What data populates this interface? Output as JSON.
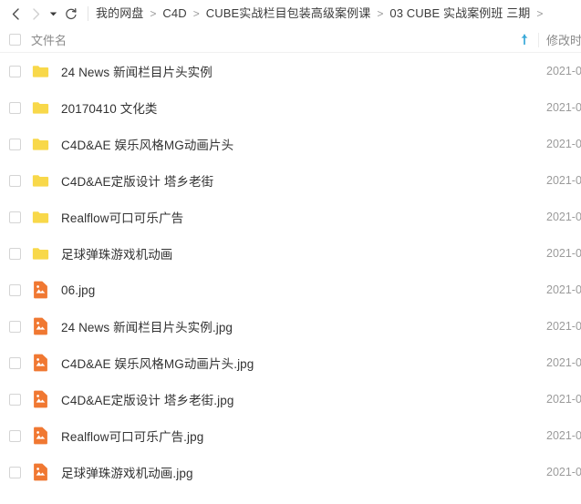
{
  "toolbar": {
    "back_icon": "chevron-left-icon",
    "forward_icon": "chevron-right-icon",
    "history_caret_icon": "caret-down-icon",
    "refresh_icon": "refresh-icon",
    "breadcrumb": [
      "我的网盘",
      "C4D",
      "CUBE实战栏目包装高级案例课",
      "03 CUBE 实战案例班 三期"
    ],
    "breadcrumb_separator": ">",
    "breadcrumb_trailing_separator": ">"
  },
  "header": {
    "select_all_label": "",
    "name_column": "文件名",
    "sort_icon": "sort-ascending-arrow-icon",
    "time_column": "修改时间"
  },
  "colors": {
    "folder": "#f8d84a",
    "image_file": "#f07832",
    "sort_arrow": "#37a8d8",
    "text": "#333333",
    "muted_text": "#8a8a8a"
  },
  "rows": [
    {
      "name": "24 News 新闻栏目片头实例",
      "type": "folder",
      "icon": "folder-icon",
      "time": "2021-0"
    },
    {
      "name": "20170410 文化类",
      "type": "folder",
      "icon": "folder-icon",
      "time": "2021-0"
    },
    {
      "name": "C4D&AE 娱乐风格MG动画片头",
      "type": "folder",
      "icon": "folder-icon",
      "time": "2021-0"
    },
    {
      "name": "C4D&AE定版设计 塔乡老街",
      "type": "folder",
      "icon": "folder-icon",
      "time": "2021-0"
    },
    {
      "name": "Realflow可口可乐广告",
      "type": "folder",
      "icon": "folder-icon",
      "time": "2021-0"
    },
    {
      "name": "足球弹珠游戏机动画",
      "type": "folder",
      "icon": "folder-icon",
      "time": "2021-0"
    },
    {
      "name": "06.jpg",
      "type": "image",
      "icon": "image-file-icon",
      "time": "2021-0"
    },
    {
      "name": "24 News 新闻栏目片头实例.jpg",
      "type": "image",
      "icon": "image-file-icon",
      "time": "2021-0"
    },
    {
      "name": "C4D&AE 娱乐风格MG动画片头.jpg",
      "type": "image",
      "icon": "image-file-icon",
      "time": "2021-0"
    },
    {
      "name": "C4D&AE定版设计 塔乡老街.jpg",
      "type": "image",
      "icon": "image-file-icon",
      "time": "2021-0"
    },
    {
      "name": "Realflow可口可乐广告.jpg",
      "type": "image",
      "icon": "image-file-icon",
      "time": "2021-0"
    },
    {
      "name": "足球弹珠游戏机动画.jpg",
      "type": "image",
      "icon": "image-file-icon",
      "time": "2021-0"
    }
  ]
}
